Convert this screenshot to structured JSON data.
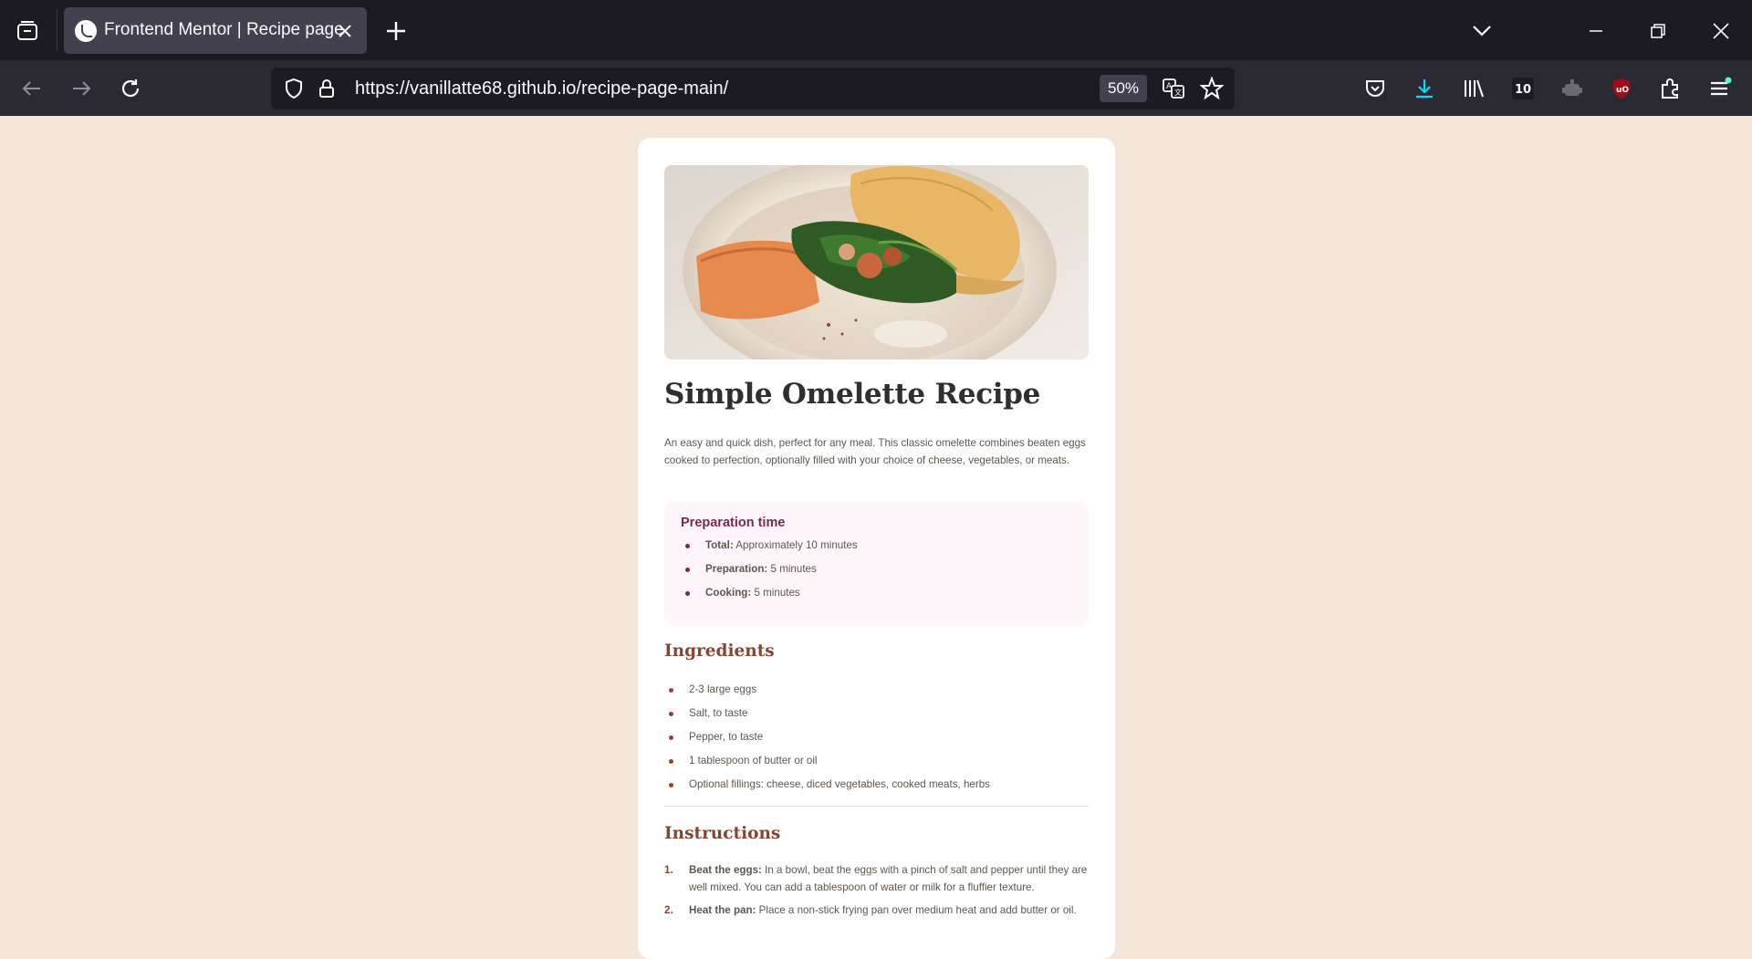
{
  "browser": {
    "tab_title": "Frontend Mentor | Recipe page",
    "url": "https://vanillatte68.github.io/recipe-page-main/",
    "zoom": "50%",
    "accent_color": "#00ddff"
  },
  "recipe": {
    "title": "Simple Omelette Recipe",
    "intro": "An easy and quick dish, perfect for any meal. This classic omelette combines beaten eggs cooked to perfection, optionally filled with your choice of cheese, vegetables, or meats.",
    "preparation": {
      "heading": "Preparation time",
      "items": [
        {
          "label": "Total:",
          "value": "Approximately 10 minutes"
        },
        {
          "label": "Preparation:",
          "value": "5 minutes"
        },
        {
          "label": "Cooking:",
          "value": "5 minutes"
        }
      ]
    },
    "ingredients": {
      "heading": "Ingredients",
      "items": [
        "2-3 large eggs",
        "Salt, to taste",
        "Pepper, to taste",
        "1 tablespoon of butter or oil",
        "Optional fillings: cheese, diced vegetables, cooked meats, herbs"
      ]
    },
    "instructions": {
      "heading": "Instructions",
      "items": [
        {
          "num": "1.",
          "label": "Beat the eggs:",
          "text": "In a bowl, beat the eggs with a pinch of salt and pepper until they are well mixed. You can add a tablespoon of water or milk for a fluffier texture."
        },
        {
          "num": "2.",
          "label": "Heat the pan:",
          "text": "Place a non-stick frying pan over medium heat and add butter or oil."
        }
      ]
    }
  }
}
